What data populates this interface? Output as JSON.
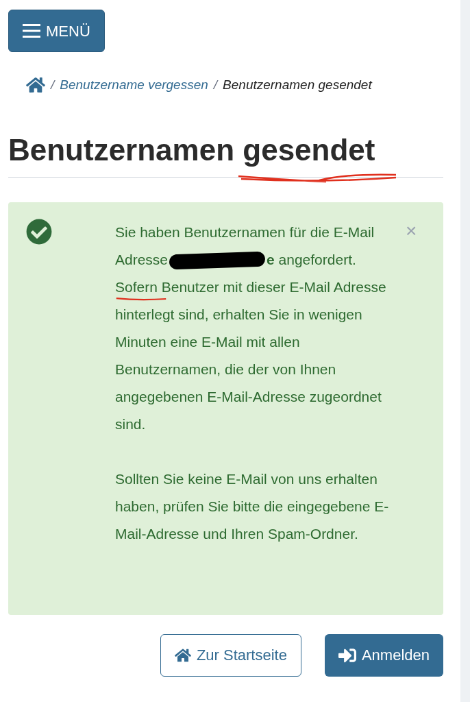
{
  "menu_button": {
    "label": "MENÜ"
  },
  "breadcrumb": [
    {
      "separator": "/",
      "label": "Benutzername vergessen",
      "kind": "link"
    },
    {
      "separator": "/",
      "label": "Benutzernamen gesendet",
      "kind": "current"
    }
  ],
  "heading": "Benutzernamen gesendet",
  "alert": {
    "paragraphs": [
      [
        "Sie haben Benutzernamen für die E-Mail Adresse",
        "**e** angefordert. Sofern Benutzer mit dieser E-Mail Adresse hinterlegt sind, erhalten Sie in wenigen Minuten eine E-Mail mit allen Benutzernamen, die der von Ihnen angegebenen E-Mail-Adresse zugeordnet sind."
      ],
      "Sollten Sie keine E-Mail von uns erhalten haben, prüfen Sie bitte die eingegebene E-Mail-Adresse und Ihren Spam-Ordner."
    ],
    "close": "×"
  },
  "buttons": [
    {
      "label": "Zur Startseite",
      "kind": "secondary"
    },
    {
      "label": "Anmelden",
      "kind": "primary"
    }
  ]
}
